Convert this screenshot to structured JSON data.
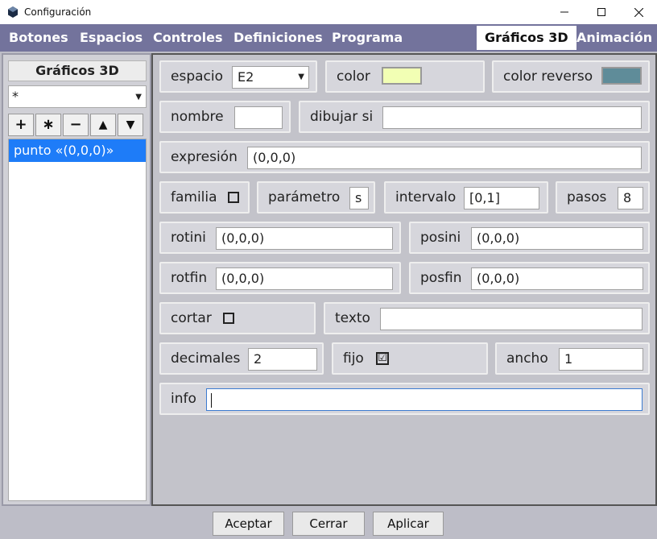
{
  "window": {
    "title": "Configuración",
    "min_icon": "minimize-icon",
    "max_icon": "maximize-icon",
    "close_icon": "close-icon"
  },
  "menu": {
    "items": [
      "Botones",
      "Espacios",
      "Controles",
      "Definiciones",
      "Programa",
      "Gráficos 3D",
      "Animación"
    ],
    "active": "Gráficos 3D"
  },
  "left": {
    "header": "Gráficos 3D",
    "select_value": "*",
    "tools": [
      "+",
      "∗",
      "−",
      "▲",
      "▼"
    ],
    "items": [
      "punto «(0,0,0)»"
    ],
    "selected_item": "punto «(0,0,0)»"
  },
  "form": {
    "espacio": {
      "label": "espacio",
      "value": "E2"
    },
    "color": {
      "label": "color",
      "value": "#f2ffb4"
    },
    "color_reverso": {
      "label": "color reverso",
      "value": "#5f8c99"
    },
    "nombre": {
      "label": "nombre",
      "value": ""
    },
    "dibujar_si": {
      "label": "dibujar si",
      "value": ""
    },
    "expresion": {
      "label": "expresión",
      "value": "(0,0,0)"
    },
    "familia": {
      "label": "familia",
      "checked": false
    },
    "parametro": {
      "label": "parámetro",
      "value": "s"
    },
    "intervalo": {
      "label": "intervalo",
      "value": "[0,1]"
    },
    "pasos": {
      "label": "pasos",
      "value": "8"
    },
    "rotini": {
      "label": "rotini",
      "value": "(0,0,0)"
    },
    "posini": {
      "label": "posini",
      "value": "(0,0,0)"
    },
    "rotfin": {
      "label": "rotfin",
      "value": "(0,0,0)"
    },
    "posfin": {
      "label": "posfin",
      "value": "(0,0,0)"
    },
    "cortar": {
      "label": "cortar",
      "checked": false
    },
    "texto": {
      "label": "texto",
      "value": ""
    },
    "decimales": {
      "label": "decimales",
      "value": "2"
    },
    "fijo": {
      "label": "fijo",
      "checked": true,
      "mark": "☑"
    },
    "ancho": {
      "label": "ancho",
      "value": "1"
    },
    "info": {
      "label": "info",
      "value": ""
    }
  },
  "buttons": {
    "aceptar": "Aceptar",
    "cerrar": "Cerrar",
    "aplicar": "Aplicar"
  }
}
